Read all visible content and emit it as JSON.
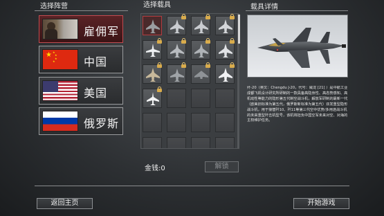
{
  "headers": {
    "faction": "选择阵营",
    "aircraft": "选择载具",
    "details": "载具详情"
  },
  "factions": [
    {
      "label": "雇佣军",
      "selected": true
    },
    {
      "label": "中国",
      "selected": false
    },
    {
      "label": "美国",
      "selected": false
    },
    {
      "label": "俄罗斯",
      "selected": false
    }
  ],
  "money": "金钱:0",
  "unlock_label": "解锁",
  "description": "歼-20（英文：Chengdu J-20，代号：威龙 [21] ）是中航工业成都飞机设计研究所研制的一款具备高隐身性、高态势感知、高机动性等能力的隐形第五代制空战斗机，解放军研制的最新一代（欧美旧标准为第五代，俄罗斯新标准为第五代）双发重型隐形战斗机，用于接替歼10、歼11等第三代空中优势/多用途战斗机的未来重型歼击机型号，该机将担负中国空军未来对空、对海的主权维护任务。",
  "buttons": {
    "back": "返回主页",
    "start": "开始游戏"
  },
  "colors": {
    "selected_faction": "#5a2326",
    "lock": "#d9ac4c"
  }
}
